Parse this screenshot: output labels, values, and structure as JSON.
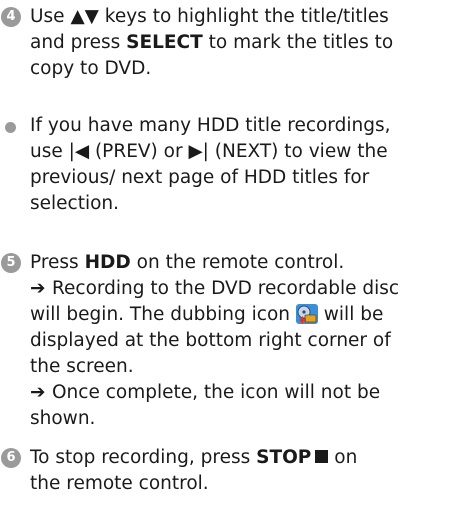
{
  "step4": {
    "number": "4",
    "l1_pre": "Use ",
    "l1_keys": "▲▼",
    "l1_post": " keys to highlight the title/titles",
    "l2_pre": "and press ",
    "l2_bold": "SELECT",
    "l2_post": " to mark the titles to",
    "l3": "copy to DVD."
  },
  "bullet": {
    "l1": "If you have many HDD title recordings,",
    "l2": "use |◀ (PREV) or ▶| (NEXT) to view the",
    "l3": "previous/ next page of HDD titles for",
    "l4": "selection."
  },
  "step5": {
    "number": "5",
    "l1_pre": "Press ",
    "l1_bold": "HDD",
    "l1_post": " on the remote control.",
    "arrow": "➔",
    "r1": "Recording to the DVD recordable disc",
    "r2_pre": "will begin. The dubbing icon ",
    "r2_post": " will be",
    "r3": "displayed at the bottom right corner of",
    "r4": "the screen.",
    "c1": "Once complete, the icon will not be",
    "c2": "shown."
  },
  "step6": {
    "number": "6",
    "l1_pre": "To stop recording, press ",
    "l1_bold": "STOP",
    "l1_post": " on",
    "l2": "the remote control."
  }
}
